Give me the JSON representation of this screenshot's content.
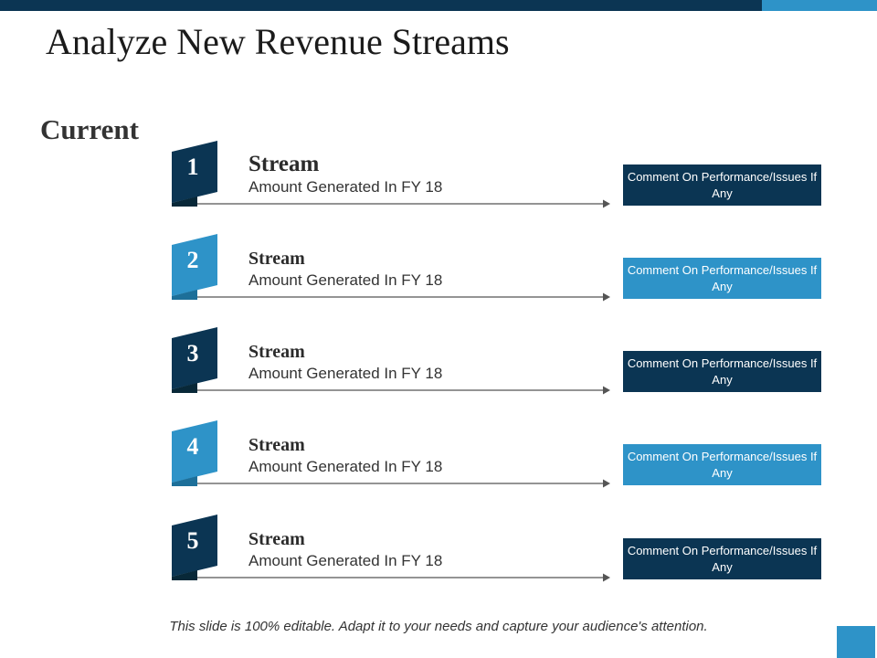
{
  "slide": {
    "title": "Analyze New Revenue Streams",
    "section_label": "Current",
    "footer_note": "This slide is 100% editable. Adapt it to your needs and capture your audience's attention.",
    "colors": {
      "dark": "#0b3553",
      "light": "#2e93c8",
      "line": "#555555"
    }
  },
  "rows": [
    {
      "number": "1",
      "title": "Stream",
      "subtitle": "Amount Generated In FY 18",
      "comment": "Comment On Performance/Issues If Any",
      "tone": "dark"
    },
    {
      "number": "2",
      "title": "Stream",
      "subtitle": "Amount Generated In FY 18",
      "comment": "Comment On Performance/Issues If Any",
      "tone": "light"
    },
    {
      "number": "3",
      "title": "Stream",
      "subtitle": "Amount Generated In FY 18",
      "comment": "Comment On Performance/Issues If Any",
      "tone": "dark"
    },
    {
      "number": "4",
      "title": "Stream",
      "subtitle": "Amount Generated In FY 18",
      "comment": "Comment On Performance/Issues If Any",
      "tone": "light"
    },
    {
      "number": "5",
      "title": "Stream",
      "subtitle": "Amount Generated In FY 18",
      "comment": "Comment On Performance/Issues If Any",
      "tone": "dark"
    }
  ]
}
